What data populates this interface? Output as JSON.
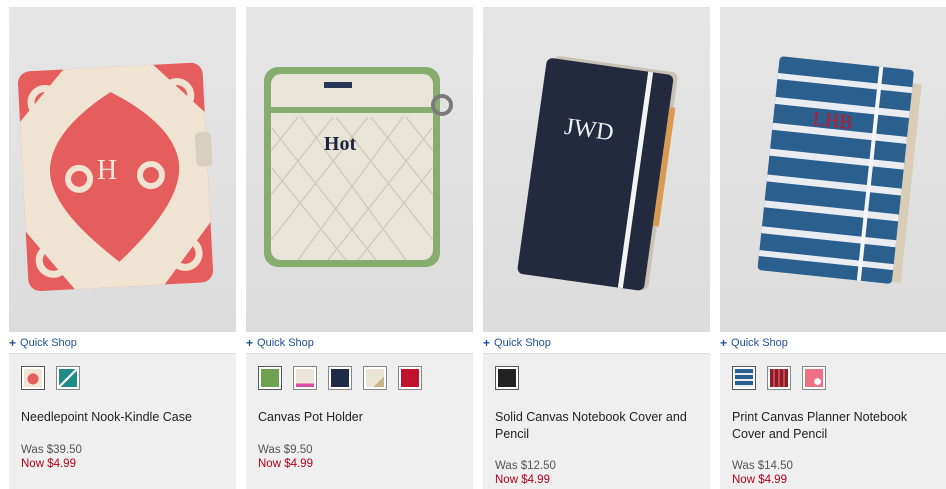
{
  "quick_shop_label": "Quick Shop",
  "colors": {
    "link": "#1f4f96",
    "sale_price": "#b0001e",
    "panel": "#efefef"
  },
  "products": [
    {
      "name": "Needlepoint Nook-Kindle Case",
      "monogram": "H",
      "was": "Was $39.50",
      "now": "Now $4.99",
      "swatches": [
        "red-needlepoint",
        "teal-pattern"
      ]
    },
    {
      "name": "Canvas Pot Holder",
      "monogram": "Hot",
      "was": "Was $9.50",
      "now": "Now $4.99",
      "swatches": [
        "green",
        "natural-pink",
        "navy",
        "natural-multi",
        "red"
      ]
    },
    {
      "name": "Solid Canvas Notebook Cover and Pencil",
      "monogram": "JWD",
      "was": "Was $12.50",
      "now": "Now $4.99",
      "swatches": [
        "black"
      ]
    },
    {
      "name": "Print Canvas Planner Notebook Cover and Pencil",
      "monogram": "LHB",
      "was": "Was $14.50",
      "now": "Now $4.99",
      "swatches": [
        "blue-stripe",
        "red-plaid",
        "pink-floral"
      ]
    }
  ]
}
